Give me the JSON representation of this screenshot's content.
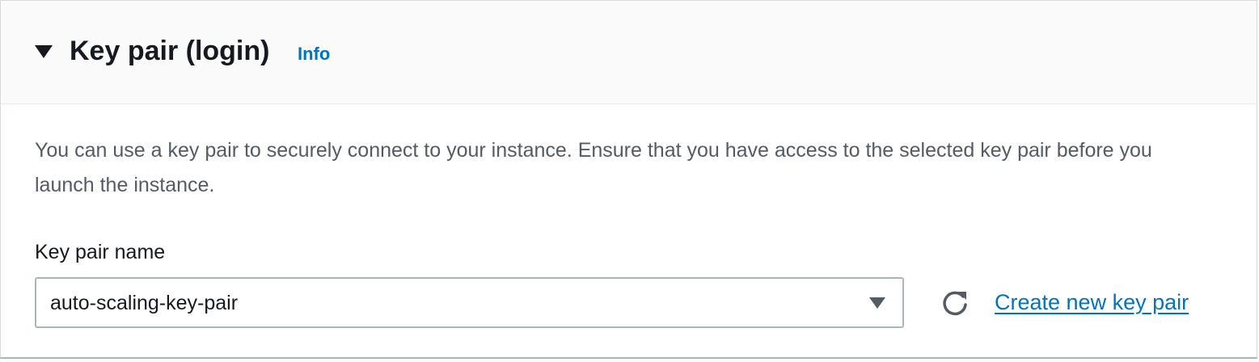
{
  "panel": {
    "title": "Key pair (login)",
    "info_link": "Info",
    "expanded": true,
    "description": "You can use a key pair to securely connect to your instance. Ensure that you have access to the selected key pair before you launch the instance."
  },
  "key_pair_field": {
    "label": "Key pair name",
    "selected_value": "auto-scaling-key-pair"
  },
  "actions": {
    "refresh_icon": "refresh-icon",
    "create_link": "Create new key pair"
  },
  "colors": {
    "link": "#0073bb",
    "title": "#16191f",
    "body_text": "#545b64",
    "header_background": "#fafafa",
    "border": "#aab7b8"
  }
}
